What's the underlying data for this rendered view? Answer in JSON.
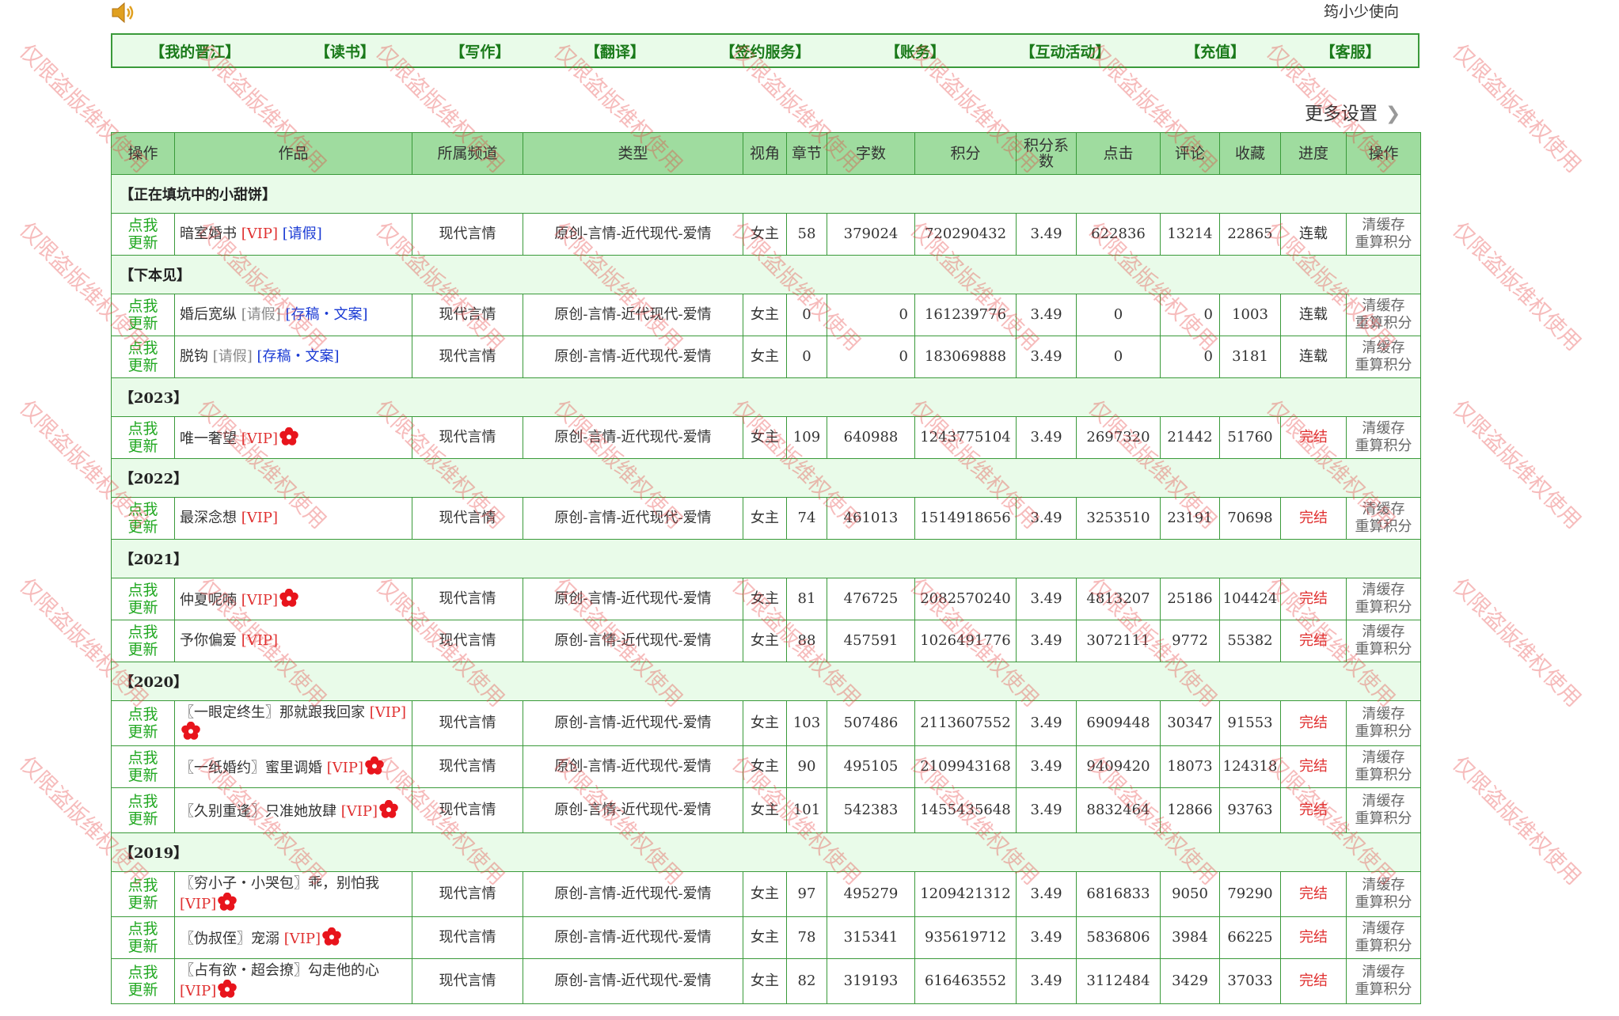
{
  "header": {
    "user_name": "筠小少使向"
  },
  "nav": [
    "【我的晋江】",
    "【读书】",
    "【写作】",
    "【翻译】",
    "【签约服务】",
    "【账务】",
    "【互动活动】",
    "【充值】",
    "【客服】"
  ],
  "more_settings": "更多设置",
  "table": {
    "headers": [
      "操作",
      "作品",
      "所属频道",
      "类型",
      "视角",
      "章节",
      "字数",
      "积分",
      "积分系数",
      "点击",
      "评论",
      "收藏",
      "进度",
      "操作"
    ],
    "update_label": "点我更新",
    "clear_label": "清缓存重算积分",
    "groups": [
      {
        "name": "【正在填坑中的小甜饼】",
        "rows": [
          {
            "title": "暗室婚书",
            "tags": [
              {
                "text": "[VIP]",
                "kind": "vip"
              },
              {
                "text": "[请假]",
                "kind": "blue"
              }
            ],
            "channel": "现代言情",
            "genre": "原创-言情-近代现代-爱情",
            "view": "女主",
            "chapters": "58",
            "words": "379024",
            "score": "720290432",
            "coef": "3.49",
            "clicks": "622836",
            "comments": "13214",
            "favs": "22865",
            "status": "连载"
          }
        ]
      },
      {
        "name": "【下本见】",
        "rows": [
          {
            "title": "婚后宽纵",
            "tags": [
              {
                "text": "[请假]",
                "kind": "grey"
              },
              {
                "text": "[存稿・文案]",
                "kind": "draft"
              }
            ],
            "channel": "现代言情",
            "genre": "原创-言情-近代现代-爱情",
            "view": "女主",
            "chapters": "0",
            "words": "0",
            "score": "161239776",
            "coef": "3.49",
            "clicks": "0",
            "comments": "0",
            "favs": "1003",
            "status": "连载"
          },
          {
            "title": "脱钩",
            "tags": [
              {
                "text": "[请假]",
                "kind": "grey"
              },
              {
                "text": "[存稿・文案]",
                "kind": "draft"
              }
            ],
            "channel": "现代言情",
            "genre": "原创-言情-近代现代-爱情",
            "view": "女主",
            "chapters": "0",
            "words": "0",
            "score": "183069888",
            "coef": "3.49",
            "clicks": "0",
            "comments": "0",
            "favs": "3181",
            "status": "连载"
          }
        ]
      },
      {
        "name": "【2023】",
        "rows": [
          {
            "title": "唯一奢望",
            "tags": [
              {
                "text": "[VIP]",
                "kind": "vip"
              }
            ],
            "flower": true,
            "channel": "现代言情",
            "genre": "原创-言情-近代现代-爱情",
            "view": "女主",
            "chapters": "109",
            "words": "640988",
            "score": "1243775104",
            "coef": "3.49",
            "clicks": "2697320",
            "comments": "21442",
            "favs": "51760",
            "status": "完结"
          }
        ]
      },
      {
        "name": "【2022】",
        "rows": [
          {
            "title": "最深念想",
            "tags": [
              {
                "text": "[VIP]",
                "kind": "vip"
              }
            ],
            "channel": "现代言情",
            "genre": "原创-言情-近代现代-爱情",
            "view": "女主",
            "chapters": "74",
            "words": "461013",
            "score": "1514918656",
            "coef": "3.49",
            "clicks": "3253510",
            "comments": "23191",
            "favs": "70698",
            "status": "完结"
          }
        ]
      },
      {
        "name": "【2021】",
        "rows": [
          {
            "title": "仲夏呢喃",
            "tags": [
              {
                "text": "[VIP]",
                "kind": "vip"
              }
            ],
            "flower": true,
            "channel": "现代言情",
            "genre": "原创-言情-近代现代-爱情",
            "view": "女主",
            "chapters": "81",
            "words": "476725",
            "score": "2082570240",
            "coef": "3.49",
            "clicks": "4813207",
            "comments": "25186",
            "favs": "104424",
            "status": "完结"
          },
          {
            "title": "予你偏爱",
            "tags": [
              {
                "text": "[VIP]",
                "kind": "vip"
              }
            ],
            "channel": "现代言情",
            "genre": "原创-言情-近代现代-爱情",
            "view": "女主",
            "chapters": "88",
            "words": "457591",
            "score": "1026491776",
            "coef": "3.49",
            "clicks": "3072111",
            "comments": "9772",
            "favs": "55382",
            "status": "完结"
          }
        ]
      },
      {
        "name": "【2020】",
        "rows": [
          {
            "title": "〖一眼定终生〗那就跟我回家",
            "tags": [
              {
                "text": "[VIP]",
                "kind": "vip"
              }
            ],
            "flower": true,
            "channel": "现代言情",
            "genre": "原创-言情-近代现代-爱情",
            "view": "女主",
            "chapters": "103",
            "words": "507486",
            "score": "2113607552",
            "coef": "3.49",
            "clicks": "6909448",
            "comments": "30347",
            "favs": "91553",
            "status": "完结"
          },
          {
            "title": "〖一纸婚约〗蜜里调婚",
            "tags": [
              {
                "text": "[VIP]",
                "kind": "vip"
              }
            ],
            "flower": true,
            "channel": "现代言情",
            "genre": "原创-言情-近代现代-爱情",
            "view": "女主",
            "chapters": "90",
            "words": "495105",
            "score": "2109943168",
            "coef": "3.49",
            "clicks": "9409420",
            "comments": "18073",
            "favs": "124318",
            "status": "完结"
          },
          {
            "title": "〖久别重逢〗只准她放肆",
            "tags": [
              {
                "text": "[VIP]",
                "kind": "vip"
              }
            ],
            "flower": true,
            "channel": "现代言情",
            "genre": "原创-言情-近代现代-爱情",
            "view": "女主",
            "chapters": "101",
            "words": "542383",
            "score": "1455435648",
            "coef": "3.49",
            "clicks": "8832464",
            "comments": "12866",
            "favs": "93763",
            "status": "完结"
          }
        ]
      },
      {
        "name": "【2019】",
        "rows": [
          {
            "title": "〖穷小子・小哭包〗乖，别怕我",
            "tags": [
              {
                "text": "[VIP]",
                "kind": "vip"
              }
            ],
            "flower": true,
            "channel": "现代言情",
            "genre": "原创-言情-近代现代-爱情",
            "view": "女主",
            "chapters": "97",
            "words": "495279",
            "score": "1209421312",
            "coef": "3.49",
            "clicks": "6816833",
            "comments": "9050",
            "favs": "79290",
            "status": "完结"
          },
          {
            "title": "〖伪叔侄〗宠溺",
            "tags": [
              {
                "text": "[VIP]",
                "kind": "vip"
              }
            ],
            "flower": true,
            "channel": "现代言情",
            "genre": "原创-言情-近代现代-爱情",
            "view": "女主",
            "chapters": "78",
            "words": "315341",
            "score": "935619712",
            "coef": "3.49",
            "clicks": "5836806",
            "comments": "3984",
            "favs": "66225",
            "status": "完结"
          },
          {
            "title": "〖占有欲・超会撩〗勾走他的心",
            "tags": [
              {
                "text": "[VIP]",
                "kind": "vip"
              }
            ],
            "flower": true,
            "channel": "现代言情",
            "genre": "原创-言情-近代现代-爱情",
            "view": "女主",
            "chapters": "82",
            "words": "319193",
            "score": "616463552",
            "coef": "3.49",
            "clicks": "3112484",
            "comments": "3429",
            "favs": "37033",
            "status": "完结"
          }
        ]
      }
    ]
  },
  "watermark_text": "仅限盗版维权使用",
  "colors": {
    "accent_green": "#3a9a3a",
    "header_bg": "#9fdc9f",
    "group_bg": "#e9fbe9",
    "done_red": "#e03030",
    "link_blue": "#1a3ad4"
  }
}
